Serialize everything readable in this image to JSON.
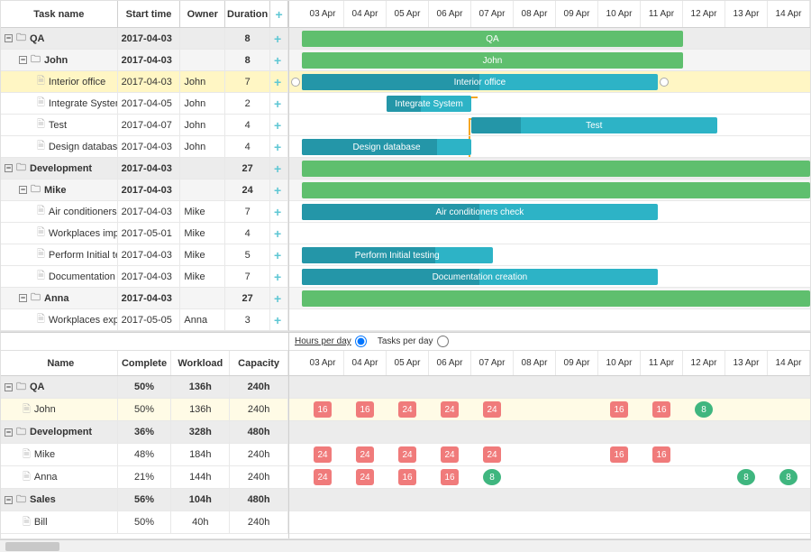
{
  "columns": {
    "task_name": "Task name",
    "start_time": "Start time",
    "owner": "Owner",
    "duration": "Duration"
  },
  "timeline": [
    "03 Apr",
    "04 Apr",
    "05 Apr",
    "06 Apr",
    "07 Apr",
    "08 Apr",
    "09 Apr",
    "10 Apr",
    "11 Apr",
    "12 Apr",
    "13 Apr",
    "14 Apr"
  ],
  "tasks": [
    {
      "id": "qa",
      "level": 1,
      "type": "group",
      "name": "QA",
      "start": "2017-04-03",
      "owner": "",
      "dur": "8",
      "bar": {
        "color": "green",
        "from": 0,
        "to": 9,
        "label": "QA"
      }
    },
    {
      "id": "john",
      "level": 2,
      "type": "owner",
      "name": "John",
      "start": "2017-04-03",
      "owner": "",
      "dur": "8",
      "bar": {
        "color": "green",
        "from": 0,
        "to": 9,
        "label": "John"
      }
    },
    {
      "id": "interior",
      "level": 3,
      "type": "task",
      "sel": true,
      "name": "Interior office",
      "start": "2017-04-03",
      "owner": "John",
      "dur": "7",
      "bar": {
        "color": "blue",
        "from": 0,
        "to": 8.4,
        "label": "Interior office",
        "prog": 0.5,
        "handles": true
      }
    },
    {
      "id": "integrate",
      "level": 3,
      "type": "task",
      "name": "Integrate System",
      "start": "2017-04-05",
      "owner": "John",
      "dur": "2",
      "bar": {
        "color": "blue",
        "from": 2,
        "to": 4,
        "label": "Integrate System",
        "prog": 0.4
      }
    },
    {
      "id": "test",
      "level": 3,
      "type": "task",
      "name": "Test",
      "start": "2017-04-07",
      "owner": "John",
      "dur": "4",
      "bar": {
        "color": "blue",
        "from": 4,
        "to": 9.8,
        "label": "Test",
        "prog": 0.2
      }
    },
    {
      "id": "designdb",
      "level": 3,
      "type": "task",
      "name": "Design database",
      "start": "2017-04-03",
      "owner": "John",
      "dur": "4",
      "bar": {
        "color": "blue",
        "from": 0,
        "to": 4,
        "label": "Design database",
        "prog": 0.8
      }
    },
    {
      "id": "dev",
      "level": 1,
      "type": "group",
      "name": "Development",
      "start": "2017-04-03",
      "owner": "",
      "dur": "27",
      "bar": {
        "color": "green",
        "from": 0,
        "to": 12,
        "label": ""
      }
    },
    {
      "id": "mike",
      "level": 2,
      "type": "owner",
      "name": "Mike",
      "start": "2017-04-03",
      "owner": "",
      "dur": "24",
      "bar": {
        "color": "green",
        "from": 0,
        "to": 12,
        "label": ""
      }
    },
    {
      "id": "ac",
      "level": 3,
      "type": "task",
      "name": "Air conditioners check",
      "start": "2017-04-03",
      "owner": "Mike",
      "dur": "7",
      "bar": {
        "color": "blue",
        "from": 0,
        "to": 8.4,
        "label": "Air conditioners check",
        "prog": 0.5
      }
    },
    {
      "id": "wi",
      "level": 3,
      "type": "task",
      "name": "Workplaces importation",
      "start": "2017-05-01",
      "owner": "Mike",
      "dur": "4"
    },
    {
      "id": "pit",
      "level": 3,
      "type": "task",
      "name": "Perform Initial testing",
      "start": "2017-04-03",
      "owner": "Mike",
      "dur": "5",
      "bar": {
        "color": "blue",
        "from": 0,
        "to": 4.5,
        "label": "Perform Initial testing",
        "prog": 0.7
      }
    },
    {
      "id": "doc",
      "level": 3,
      "type": "task",
      "name": "Documentation creation",
      "start": "2017-04-03",
      "owner": "Mike",
      "dur": "7",
      "bar": {
        "color": "blue",
        "from": 0,
        "to": 8.4,
        "label": "Documentation creation",
        "prog": 0.5
      }
    },
    {
      "id": "anna",
      "level": 2,
      "type": "owner",
      "name": "Anna",
      "start": "2017-04-03",
      "owner": "",
      "dur": "27",
      "bar": {
        "color": "green",
        "from": 0,
        "to": 12,
        "label": ""
      }
    },
    {
      "id": "we",
      "level": 3,
      "type": "task",
      "name": "Workplaces exportation",
      "start": "2017-05-05",
      "owner": "Anna",
      "dur": "3"
    }
  ],
  "res_columns": {
    "name": "Name",
    "complete": "Complete",
    "workload": "Workload",
    "capacity": "Capacity"
  },
  "modes": {
    "hours": "Hours per day",
    "tasks": "Tasks per day",
    "selected": "hours"
  },
  "resources": [
    {
      "type": "group",
      "name": "QA",
      "complete": "50%",
      "workload": "136h",
      "capacity": "240h"
    },
    {
      "type": "person",
      "sel": true,
      "name": "John",
      "complete": "50%",
      "workload": "136h",
      "capacity": "240h",
      "cells": [
        {
          "d": 0,
          "v": "16",
          "c": "red"
        },
        {
          "d": 1,
          "v": "16",
          "c": "red"
        },
        {
          "d": 2,
          "v": "24",
          "c": "red"
        },
        {
          "d": 3,
          "v": "24",
          "c": "red"
        },
        {
          "d": 4,
          "v": "24",
          "c": "red"
        },
        {
          "d": 7,
          "v": "16",
          "c": "red"
        },
        {
          "d": 8,
          "v": "16",
          "c": "red"
        },
        {
          "d": 9,
          "v": "8",
          "c": "grn"
        }
      ]
    },
    {
      "type": "group",
      "name": "Development",
      "complete": "36%",
      "workload": "328h",
      "capacity": "480h"
    },
    {
      "type": "person",
      "name": "Mike",
      "complete": "48%",
      "workload": "184h",
      "capacity": "240h",
      "cells": [
        {
          "d": 0,
          "v": "24",
          "c": "red"
        },
        {
          "d": 1,
          "v": "24",
          "c": "red"
        },
        {
          "d": 2,
          "v": "24",
          "c": "red"
        },
        {
          "d": 3,
          "v": "24",
          "c": "red"
        },
        {
          "d": 4,
          "v": "24",
          "c": "red"
        },
        {
          "d": 7,
          "v": "16",
          "c": "red"
        },
        {
          "d": 8,
          "v": "16",
          "c": "red"
        }
      ]
    },
    {
      "type": "person",
      "name": "Anna",
      "complete": "21%",
      "workload": "144h",
      "capacity": "240h",
      "cells": [
        {
          "d": 0,
          "v": "24",
          "c": "red"
        },
        {
          "d": 1,
          "v": "24",
          "c": "red"
        },
        {
          "d": 2,
          "v": "16",
          "c": "red"
        },
        {
          "d": 3,
          "v": "16",
          "c": "red"
        },
        {
          "d": 4,
          "v": "8",
          "c": "grn"
        },
        {
          "d": 10,
          "v": "8",
          "c": "grn"
        },
        {
          "d": 11,
          "v": "8",
          "c": "grn"
        }
      ]
    },
    {
      "type": "group",
      "name": "Sales",
      "complete": "56%",
      "workload": "104h",
      "capacity": "480h"
    },
    {
      "type": "person",
      "name": "Bill",
      "complete": "50%",
      "workload": "40h",
      "capacity": "240h",
      "cells": []
    }
  ],
  "chart_data": {
    "type": "gantt",
    "date_axis": [
      "2017-04-03",
      "2017-04-04",
      "2017-04-05",
      "2017-04-06",
      "2017-04-07",
      "2017-04-08",
      "2017-04-09",
      "2017-04-10",
      "2017-04-11",
      "2017-04-12",
      "2017-04-13",
      "2017-04-14"
    ],
    "tasks": [
      {
        "name": "QA",
        "start": "2017-04-03",
        "duration": 8,
        "type": "summary"
      },
      {
        "name": "John",
        "start": "2017-04-03",
        "duration": 8,
        "type": "summary"
      },
      {
        "name": "Interior office",
        "start": "2017-04-03",
        "duration": 7,
        "owner": "John",
        "progress": 0.5
      },
      {
        "name": "Integrate System",
        "start": "2017-04-05",
        "duration": 2,
        "owner": "John",
        "progress": 0.4
      },
      {
        "name": "Test",
        "start": "2017-04-07",
        "duration": 4,
        "owner": "John",
        "progress": 0.2
      },
      {
        "name": "Design database",
        "start": "2017-04-03",
        "duration": 4,
        "owner": "John",
        "progress": 0.8
      },
      {
        "name": "Development",
        "start": "2017-04-03",
        "duration": 27,
        "type": "summary"
      },
      {
        "name": "Mike",
        "start": "2017-04-03",
        "duration": 24,
        "type": "summary"
      },
      {
        "name": "Air conditioners check",
        "start": "2017-04-03",
        "duration": 7,
        "owner": "Mike",
        "progress": 0.5
      },
      {
        "name": "Workplaces importation",
        "start": "2017-05-01",
        "duration": 4,
        "owner": "Mike"
      },
      {
        "name": "Perform Initial testing",
        "start": "2017-04-03",
        "duration": 5,
        "owner": "Mike",
        "progress": 0.7
      },
      {
        "name": "Documentation creation",
        "start": "2017-04-03",
        "duration": 7,
        "owner": "Mike",
        "progress": 0.5
      },
      {
        "name": "Anna",
        "start": "2017-04-03",
        "duration": 27,
        "type": "summary"
      },
      {
        "name": "Workplaces exportation",
        "start": "2017-05-05",
        "duration": 3,
        "owner": "Anna"
      }
    ],
    "dependencies": [
      [
        "Design database",
        "Integrate System"
      ],
      [
        "Integrate System",
        "Test"
      ]
    ],
    "workload": {
      "unit": "hours_per_day",
      "threshold": 8,
      "John": {
        "2017-04-03": 16,
        "2017-04-04": 16,
        "2017-04-05": 24,
        "2017-04-06": 24,
        "2017-04-07": 24,
        "2017-04-10": 16,
        "2017-04-11": 16,
        "2017-04-12": 8
      },
      "Mike": {
        "2017-04-03": 24,
        "2017-04-04": 24,
        "2017-04-05": 24,
        "2017-04-06": 24,
        "2017-04-07": 24,
        "2017-04-10": 16,
        "2017-04-11": 16
      },
      "Anna": {
        "2017-04-03": 24,
        "2017-04-04": 24,
        "2017-04-05": 16,
        "2017-04-06": 16,
        "2017-04-07": 8,
        "2017-04-13": 8,
        "2017-04-14": 8
      }
    }
  }
}
